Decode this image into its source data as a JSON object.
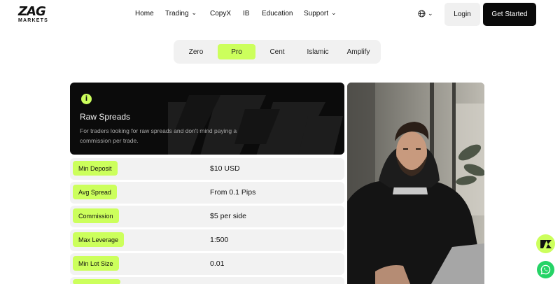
{
  "brand": {
    "logo_mark": "ZAG",
    "logo_sub": "MARKETS"
  },
  "nav": {
    "home": "Home",
    "trading": "Trading",
    "copyx": "CopyX",
    "ib": "IB",
    "education": "Education",
    "support": "Support"
  },
  "header": {
    "login": "Login",
    "get_started": "Get Started"
  },
  "tabs": [
    "Zero",
    "Pro",
    "Cent",
    "Islamic",
    "Amplify"
  ],
  "active_tab": "Pro",
  "hero": {
    "icon": "i",
    "title": "Raw Spreads",
    "description": "For traders looking for raw spreads and don't mind paying a commission per trade."
  },
  "specs": [
    {
      "label": "Min Deposit",
      "value": "$10 USD"
    },
    {
      "label": "Avg Spread",
      "value": "From 0.1 Pips"
    },
    {
      "label": "Commission",
      "value": "$5 per side"
    },
    {
      "label": "Max Leverage",
      "value": "1:500"
    },
    {
      "label": "Min Lot Size",
      "value": "0.01"
    }
  ],
  "colors": {
    "accent": "#ccff5c",
    "dark": "#0b0b0b",
    "whatsapp": "#25d366"
  },
  "icons": [
    "globe-icon",
    "chevron-down-icon",
    "info-icon",
    "zr-chat-icon",
    "whatsapp-icon"
  ]
}
